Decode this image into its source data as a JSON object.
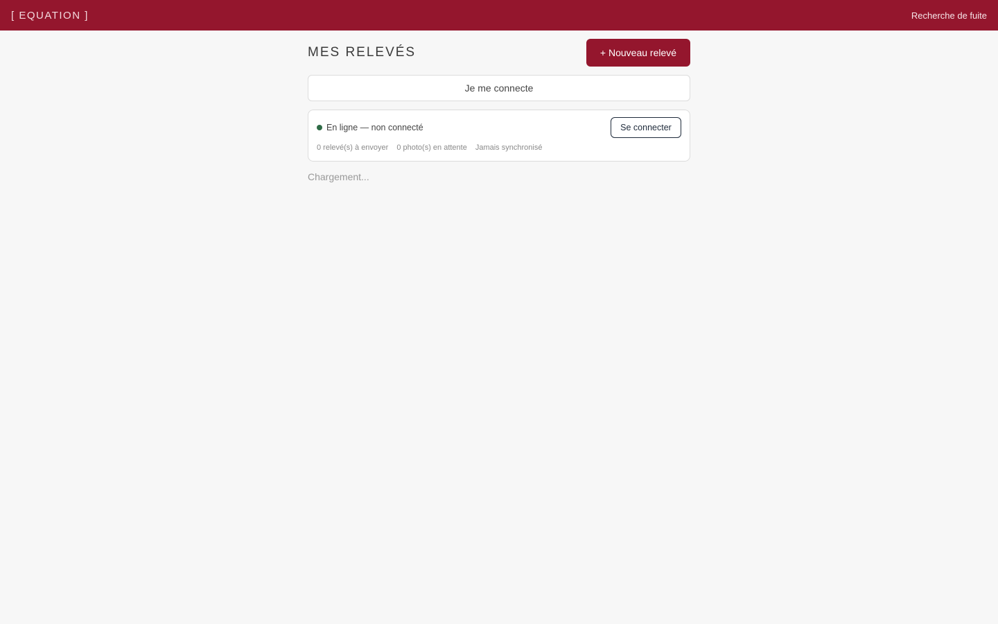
{
  "topbar": {
    "brand": "[ EQUATION ]",
    "link": "Recherche de fuite"
  },
  "header": {
    "title": "MES RELEVÉS",
    "new_button": "+ Nouveau relevé"
  },
  "connect_banner": {
    "label": "Je me connecte"
  },
  "status": {
    "state_text": "En ligne — non connecté",
    "login_button": "Se connecter",
    "pending_reports": "0 relevé(s) à envoyer",
    "pending_photos": "0 photo(s) en attente",
    "last_sync": "Jamais synchronisé"
  },
  "loading_text": "Chargement...",
  "colors": {
    "brand": "#94162d",
    "online_dot": "#2f6b46"
  }
}
